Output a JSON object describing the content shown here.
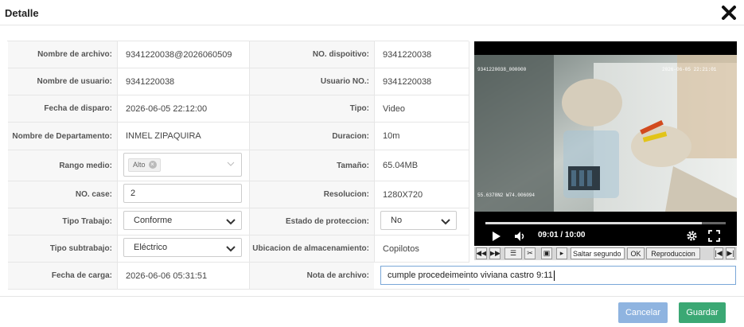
{
  "dialog": {
    "title": "Detalle"
  },
  "fields": {
    "nombre_archivo": {
      "label": "Nombre de archivo:",
      "value": "9341220038@2026060509"
    },
    "no_dispositivo": {
      "label": "NO. dispoitivo:",
      "value": "9341220038"
    },
    "nombre_usuario": {
      "label": "Nombre de usuario:",
      "value": "9341220038"
    },
    "usuario_no": {
      "label": "Usuario NO.:",
      "value": "9341220038"
    },
    "fecha_disparo": {
      "label": "Fecha de disparo:",
      "value": "2026-06-05 22:12:00"
    },
    "tipo": {
      "label": "Tipo:",
      "value": "Video"
    },
    "departamento": {
      "label": "Nombre de Departamento:",
      "value": "INMEL ZIPAQUIRA"
    },
    "duracion": {
      "label": "Duracion:",
      "value": "10m"
    },
    "rango_medio": {
      "label": "Rango medio:",
      "tag": "Alto"
    },
    "tamano": {
      "label": "Tamaño:",
      "value": "65.04MB"
    },
    "no_case": {
      "label": "NO. case:",
      "value": "2"
    },
    "resolucion": {
      "label": "Resolucion:",
      "value": "1280X720"
    },
    "tipo_trabajo": {
      "label": "Tipo Trabajo:",
      "value": "Conforme"
    },
    "estado_proteccion": {
      "label": "Estado de proteccion:",
      "value": "No"
    },
    "tipo_subtrabajo": {
      "label": "Tipo subtrabajo:",
      "value": "Eléctrico"
    },
    "ubicacion": {
      "label": "Ubicacion de almacenamiento:",
      "value": "Copilotos"
    },
    "fecha_carga": {
      "label": "Fecha de carga:",
      "value": "2026-06-06 05:31:51"
    },
    "nota_archivo": {
      "label": "Nota de archivo:",
      "value": "cumple procedeimeinto viviana castro 9:11"
    }
  },
  "player": {
    "time": "09:01 / 10:00",
    "progress": 0.9,
    "overlay_left": "9341220038_000000",
    "overlay_right": "2026-06-05 22:21:01",
    "overlay_bottom": "55.6378N2 W74.006094",
    "icons": [
      "play-icon",
      "volume-icon",
      "gear-icon",
      "fullscreen-icon"
    ],
    "toolbar": {
      "skip_placeholder": "Saltar segundo",
      "ok_label": "OK",
      "reproduccion_label": "Reproduccion"
    }
  },
  "footer": {
    "cancel_label": "Cancelar",
    "save_label": "Guardar"
  },
  "colors": {
    "cancel": "#8fb4e0",
    "save": "#3ba874",
    "label_bg": "#f7f7f7"
  }
}
